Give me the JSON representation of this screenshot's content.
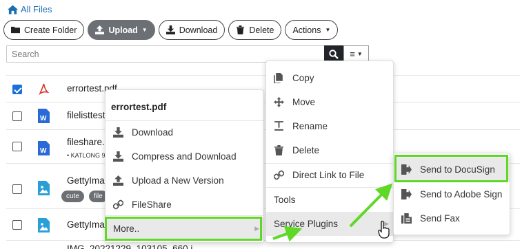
{
  "breadcrumb": {
    "label": "All Files"
  },
  "toolbar": {
    "create_folder": "Create Folder",
    "upload": "Upload",
    "download": "Download",
    "delete": "Delete",
    "actions": "Actions"
  },
  "search": {
    "placeholder": "Search"
  },
  "files": [
    {
      "name": "errortest.pdf",
      "type": "pdf",
      "checked": true
    },
    {
      "name": "filelisttestin",
      "type": "word",
      "checked": false
    },
    {
      "name": "fileshare.do",
      "sub": "• KATLONG 9/",
      "type": "word",
      "checked": false
    },
    {
      "name": "GettyImag",
      "tags": [
        "cute",
        "file"
      ],
      "type": "image",
      "checked": false
    },
    {
      "name": "GettyImag",
      "type": "image",
      "checked": false
    },
    {
      "name": "IMG_20221229_103105_660.j",
      "type": "image",
      "checked": false
    }
  ],
  "file_menu": {
    "title": "errortest.pdf",
    "items": [
      "Download",
      "Compress and Download",
      "Upload a New Version",
      "FileShare",
      "More.."
    ]
  },
  "more_menu": {
    "items": [
      "Copy",
      "Move",
      "Rename",
      "Delete",
      "Direct Link to File"
    ],
    "tools": "Tools",
    "service_plugins": "Service Plugins"
  },
  "plugins_menu": {
    "items": [
      "Send to DocuSign",
      "Send to Adobe Sign",
      "Send Fax"
    ]
  },
  "colors": {
    "accent": "#1a6fb3",
    "highlight": "#5fd826",
    "pdf": "#d9342b",
    "word": "#2b6ad6",
    "image": "#2a9fd6"
  }
}
